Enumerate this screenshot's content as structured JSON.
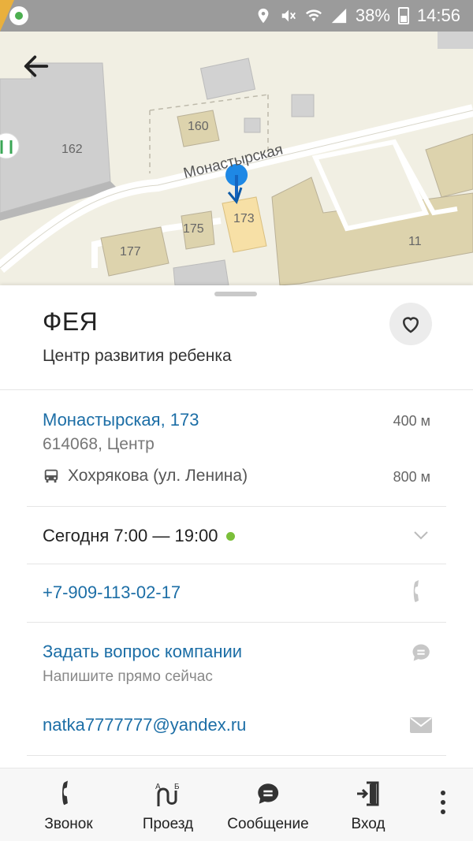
{
  "status_bar": {
    "battery_percent": "38%",
    "time": "14:56",
    "icons": [
      "location-icon",
      "mute-icon",
      "wifi-icon",
      "signal-icon",
      "battery-icon"
    ]
  },
  "map": {
    "street_name": "Монастырская",
    "building_labels": [
      "160",
      "162",
      "173",
      "175",
      "177",
      "11"
    ]
  },
  "place": {
    "name": "ФЕЯ",
    "category": "Центр развития ребенка"
  },
  "address": {
    "line": "Монастырская, 173",
    "distance": "400 м",
    "postal": "614068, Центр",
    "transit_stop": "Хохрякова (ул. Ленина)",
    "transit_distance": "800 м"
  },
  "hours": {
    "text": "Сегодня 7:00 — 19:00",
    "status_color": "#7bbf3a"
  },
  "contact": {
    "phone": "+7-909-113-02-17",
    "ask_title": "Задать вопрос компании",
    "ask_subtitle": "Напишите прямо сейчас",
    "email": "natka7777777@yandex.ru"
  },
  "bottom_actions": [
    {
      "label": "Звонок",
      "icon": "phone-icon"
    },
    {
      "label": "Проезд",
      "icon": "route-icon"
    },
    {
      "label": "Сообщение",
      "icon": "message-icon"
    },
    {
      "label": "Вход",
      "icon": "entrance-icon"
    }
  ],
  "colors": {
    "link": "#1c6ea6",
    "pin": "#1e88e5",
    "map_bg": "#f1efe3"
  }
}
